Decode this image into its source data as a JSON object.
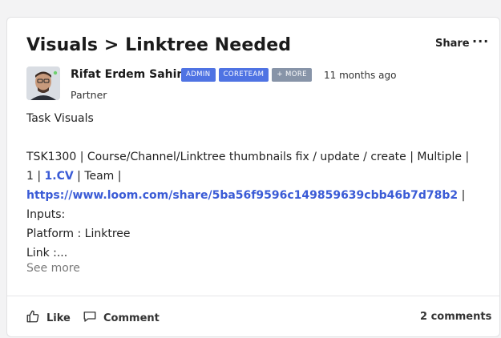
{
  "post": {
    "title": "Visuals > Linktree Needed",
    "share_label": "Share",
    "more_label": "···",
    "author": {
      "name": "Rifat Erdem Sahin",
      "role": "Partner",
      "time_ago": "11 months ago",
      "badges": [
        {
          "label": "ADMIN",
          "color": "#4f73e3"
        },
        {
          "label": "CORETEAM",
          "color": "#4f73e3"
        },
        {
          "label": "+ MORE",
          "color": "#8794a8"
        }
      ]
    },
    "body": {
      "line1": "Task Visuals",
      "line2": "TSK1300 | Course/Channel/Linktree thumbnails fix / update / create | Multiple |",
      "line3_prefix": "1 | ",
      "line3_link": "1.CV",
      "line3_suffix": " | Team |",
      "line4_link": "https://www.loom.com/share/5ba56f9596c149859639cbb46b7d78b2",
      "line4_suffix": " |",
      "line5": "Inputs:",
      "line6": "Platform : Linktree",
      "line7": "Link :..."
    },
    "see_more_label": "See more",
    "actions": {
      "like_label": "Like",
      "comment_label": "Comment",
      "comments_count": "2 comments"
    }
  },
  "colors": {
    "link": "#3a5bd6",
    "badge_blue": "#4f73e3",
    "badge_gray": "#8794a8"
  }
}
